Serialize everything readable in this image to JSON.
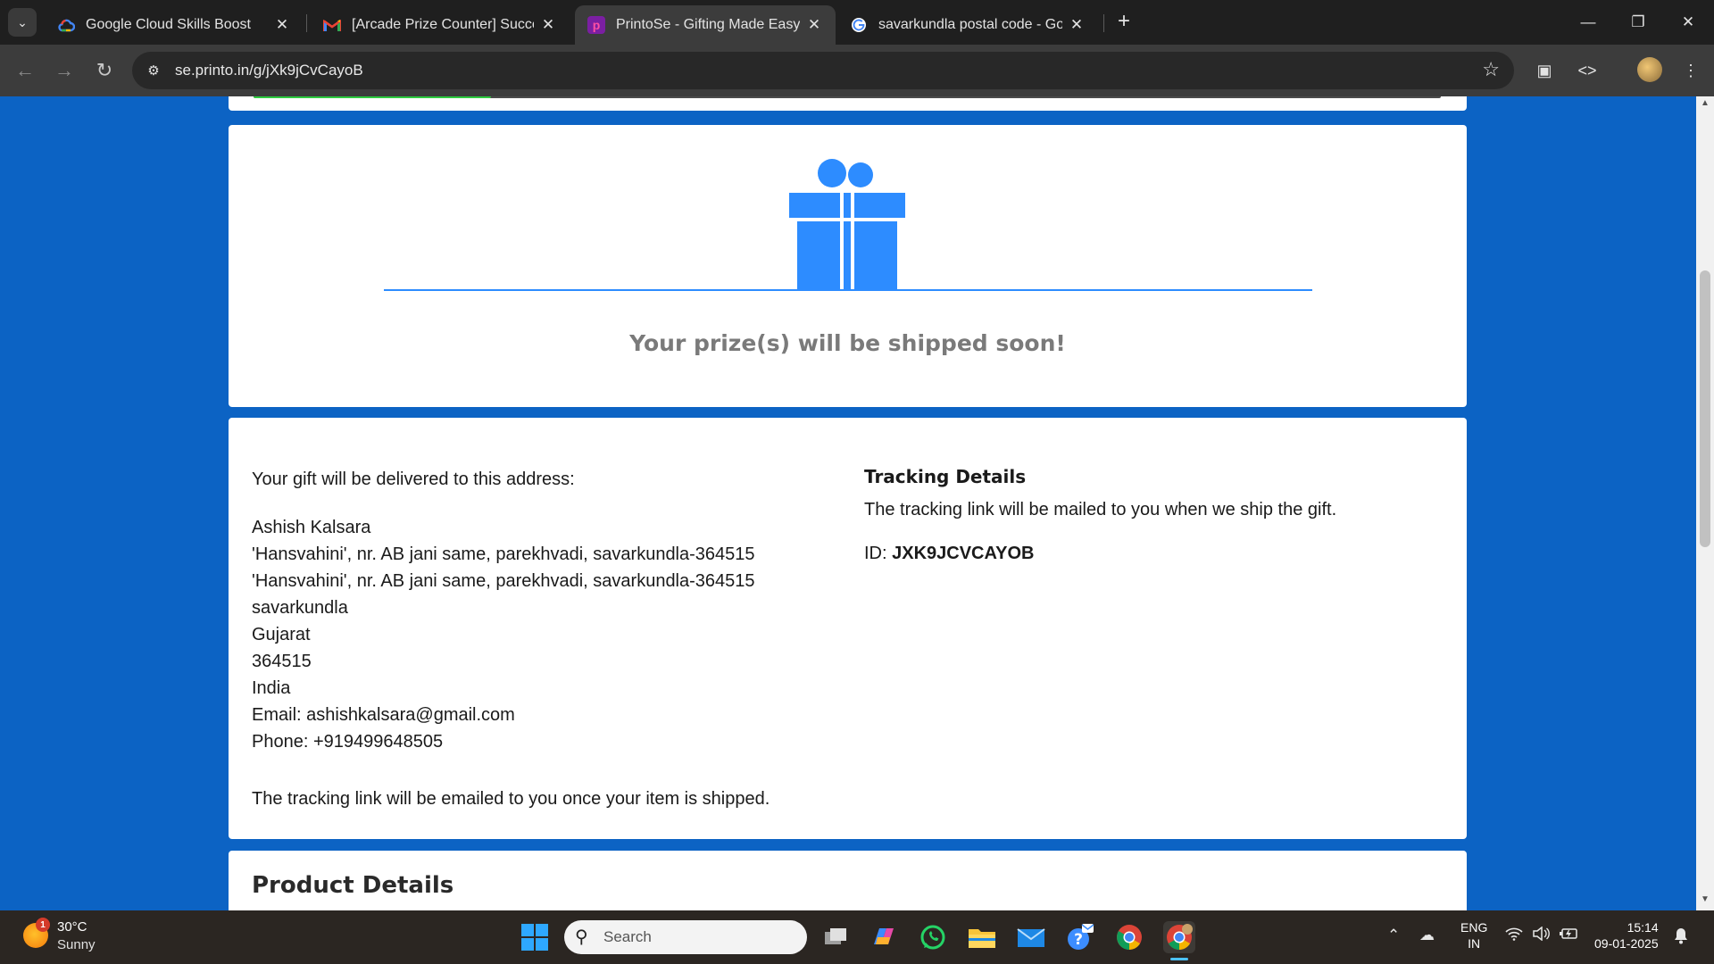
{
  "browser": {
    "tabs": [
      {
        "title": "Google Cloud Skills Boost",
        "icon": "google-cloud-icon"
      },
      {
        "title": "[Arcade Prize Counter] Success",
        "icon": "gmail-icon"
      },
      {
        "title": "PrintoSe - Gifting Made Easy",
        "icon": "printose-icon",
        "active": true
      },
      {
        "title": "savarkundla postal code - Goog",
        "icon": "google-icon"
      }
    ],
    "url": "se.printo.in/g/jXk9jCvCayoB"
  },
  "page": {
    "progress_fraction": 0.2,
    "ship_message": "Your prize(s) will be shipped soon!",
    "address": {
      "intro": "Your gift will be delivered to this address:",
      "name": "Ashish Kalsara",
      "line1": "'Hansvahini', nr. AB jani same, parekhvadi, savarkundla-364515",
      "line2": "'Hansvahini', nr. AB jani same, parekhvadi, savarkundla-364515",
      "city": "savarkundla",
      "state": "Gujarat",
      "pin": "364515",
      "country": "India",
      "email": "Email: ashishkalsara@gmail.com",
      "phone": "Phone: +919499648505",
      "note": "The tracking link will be emailed to you once your item is shipped."
    },
    "tracking": {
      "title": "Tracking Details",
      "text": "The tracking link will be mailed to you when we ship the gift.",
      "id_label": "ID:",
      "id_value": "JXK9JCVCAYOB"
    },
    "product": {
      "title": "Product Details"
    },
    "colors": {
      "page_background": "#0c63c4",
      "gift_blue": "#2d8cff",
      "progress_green": "#2ecc40"
    }
  },
  "taskbar": {
    "weather": {
      "temp": "30°C",
      "desc": "Sunny",
      "badge": "1"
    },
    "search_placeholder": "Search",
    "lang": {
      "line1": "ENG",
      "line2": "IN"
    },
    "clock": {
      "time": "15:14",
      "date": "09-01-2025"
    }
  }
}
